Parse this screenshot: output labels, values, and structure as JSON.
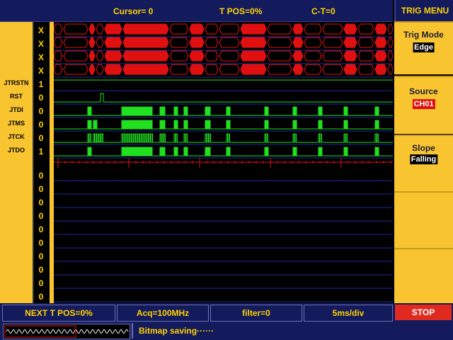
{
  "topbar": {
    "cursor": "Cursor= 0",
    "tpos": "T POS=0%",
    "ct": "C-T=0"
  },
  "menu": {
    "title": "TRIG MENU",
    "items": [
      {
        "label": "Trig Mode",
        "value": "Edge"
      },
      {
        "label": "Source",
        "value": "CH01"
      },
      {
        "label": "Slope",
        "value": "Falling"
      },
      {
        "label": "",
        "value": ""
      },
      {
        "label": "",
        "value": ""
      }
    ]
  },
  "channels": {
    "labels": [
      "JTRSTN",
      "RST",
      "JTDI",
      "JTMS",
      "JTCK",
      "JTDO"
    ],
    "bus_values": [
      "X",
      "X",
      "X",
      "X"
    ],
    "signal_values": [
      "1",
      "0",
      "0",
      "0",
      "0",
      "1"
    ],
    "idle_values": [
      "0",
      "0",
      "0",
      "0",
      "0",
      "0",
      "0",
      "0",
      "0",
      "0"
    ]
  },
  "bottom": {
    "next_tpos": "NEXT T POS=0%",
    "acq": "Acq=100MHz",
    "filter": "filter=0",
    "timebase": "5ms/div",
    "stop": "STOP"
  },
  "status": {
    "message": "Bitmap saving······"
  },
  "colors": {
    "accent": "#f8c530",
    "bar": "#141b5c",
    "bus": "#e01010",
    "signal": "#20e020",
    "stop": "#e02a20"
  }
}
